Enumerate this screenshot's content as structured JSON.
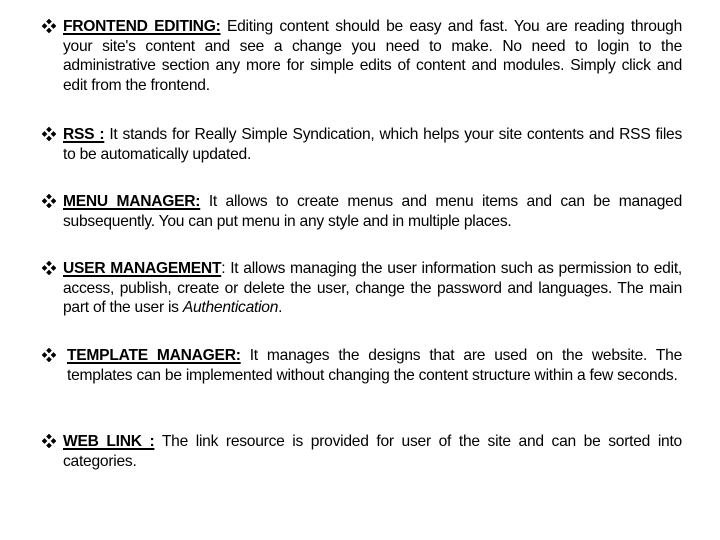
{
  "bullet_icon": "diamond-four-dots-icon",
  "items": [
    {
      "term": "FRONTEND EDITING:",
      "text": " Editing content should be easy and fast. You are reading through your site's content and see a change you need to make. No need to login to the administrative section any more for simple edits of content and modules. Simply click and edit from the frontend."
    },
    {
      "term": "RSS :",
      "text": " It stands for Really Simple Syndication, which helps your site contents and RSS files to be automatically updated."
    },
    {
      "term": "MENU MANAGER:",
      "text": " It allows to create menus and menu items and can be managed subsequently. You can put menu in any style and in multiple places."
    },
    {
      "term": "USER MANAGEMENT",
      "text": ": It allows managing the user information such as permission to edit, access, publish, create or delete the user, change the password and languages. The main part of the user  is ",
      "emphasis": "Authentication",
      "text_end": "."
    },
    {
      "term": "TEMPLATE MANAGER:",
      "text": " It manages the designs that are used on the website. The templates can be implemented without changing the content structure within a few seconds."
    },
    {
      "term": "WEB LINK :",
      "text": " The link resource is provided for user of the site and can be sorted into categories."
    }
  ]
}
